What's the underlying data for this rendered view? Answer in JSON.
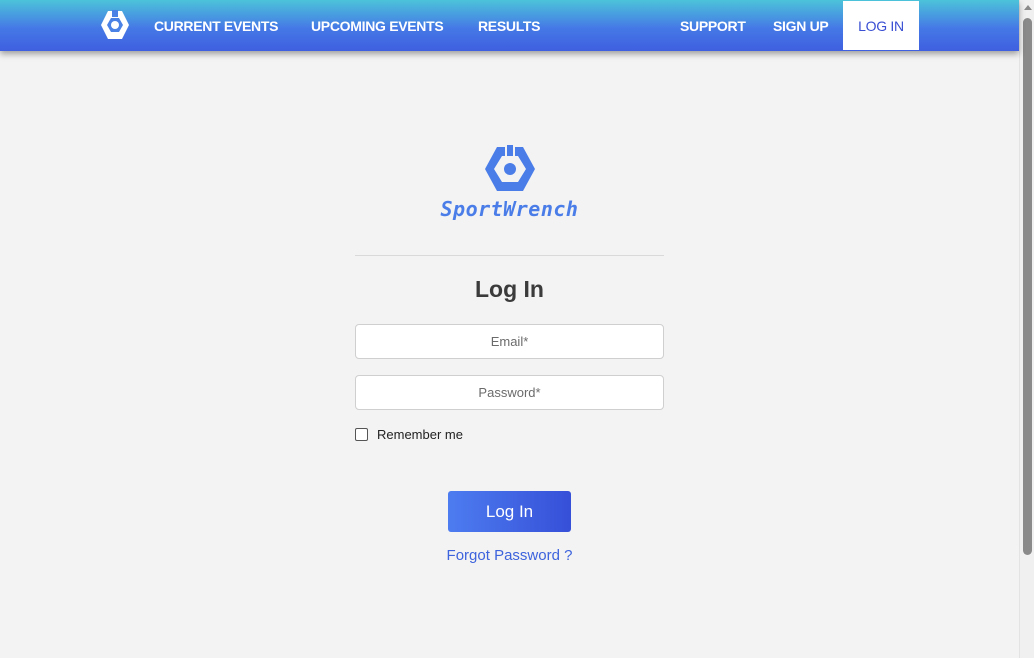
{
  "nav": {
    "logo_icon": "sportwrench-hex-icon",
    "items": [
      {
        "label": "CURRENT EVENTS"
      },
      {
        "label": "UPCOMING EVENTS"
      },
      {
        "label": "RESULTS"
      },
      {
        "label": "SUPPORT"
      },
      {
        "label": "SIGN UP"
      },
      {
        "label": "LOG IN",
        "active": true
      }
    ]
  },
  "brand": {
    "name": "SportWrench",
    "color": "#4a7de8"
  },
  "form": {
    "title": "Log In",
    "email_placeholder": "Email*",
    "password_placeholder": "Password*",
    "remember_label": "Remember me",
    "remember_checked": false,
    "submit_label": "Log In",
    "forgot_label": "Forgot Password ?"
  },
  "colors": {
    "accent": "#3d63dd",
    "nav_gradient_top": "#4cc3d9",
    "nav_gradient_bottom": "#3f5fe0",
    "background": "#f3f3f3"
  }
}
